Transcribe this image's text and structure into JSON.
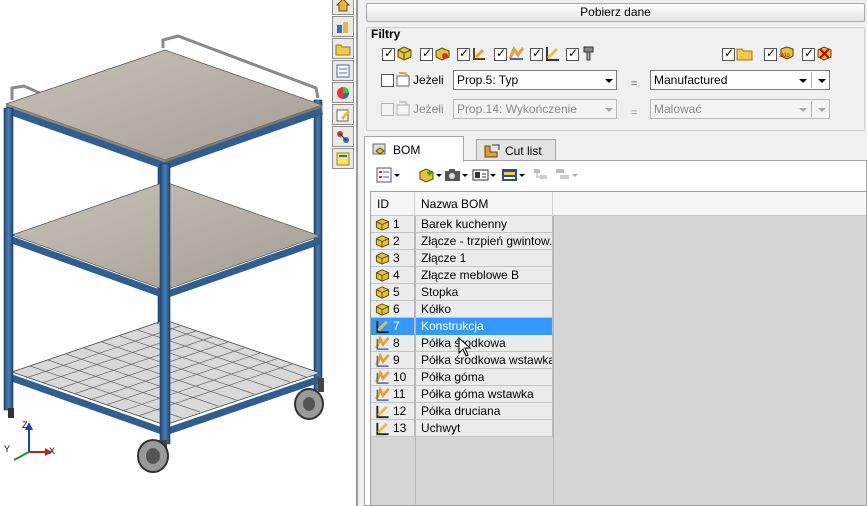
{
  "viewport": {
    "axis_labels": {
      "x": "X",
      "y": "Y",
      "z": "Z"
    }
  },
  "side_toolbar": {
    "icons": [
      "home-icon",
      "assembly-icon",
      "folder-icon",
      "properties-icon",
      "appearance-icon",
      "edit-icon",
      "routing-icon",
      "notes-icon"
    ]
  },
  "panel": {
    "fetch_button": "Pobierz dane",
    "filters": {
      "title": "Filtry",
      "type_filters": [
        {
          "icon": "part-icon",
          "checked": true
        },
        {
          "icon": "assembly-part-icon",
          "checked": true
        },
        {
          "icon": "weldment-icon",
          "checked": true
        },
        {
          "icon": "sheetmetal-icon",
          "checked": true
        },
        {
          "icon": "structural-member-icon",
          "checked": true
        },
        {
          "icon": "fastener-icon",
          "checked": true
        }
      ],
      "extra_filters": [
        {
          "icon": "folder-icon",
          "checked": true
        },
        {
          "icon": "skip-icon",
          "checked": true,
          "label": "skip"
        },
        {
          "icon": "exclude-icon",
          "checked": true
        }
      ],
      "conditions": [
        {
          "enabled": true,
          "checked": false,
          "label": "Jeżeli",
          "property": "Prop.5: Typ",
          "operator": "=",
          "value": "Manufactured"
        },
        {
          "enabled": false,
          "checked": false,
          "label": "Jeżeli",
          "property": "Prop.14: Wykończenie",
          "operator": "=",
          "value": "Malować"
        }
      ]
    },
    "tabs": [
      {
        "label": "BOM",
        "active": true
      },
      {
        "label": "Cut list",
        "active": false
      }
    ],
    "bom_table": {
      "columns": [
        "ID",
        "Nazwa BOM"
      ],
      "rows": [
        {
          "id": "1",
          "name": "Barek kuchenny",
          "type": "assembly"
        },
        {
          "id": "2",
          "name": "Złącze - trzpień gwintow...",
          "type": "assembly"
        },
        {
          "id": "3",
          "name": "Złącze 1",
          "type": "assembly"
        },
        {
          "id": "4",
          "name": "Złącze meblowe B",
          "type": "assembly"
        },
        {
          "id": "5",
          "name": "Stopka",
          "type": "assembly"
        },
        {
          "id": "6",
          "name": "Kółko",
          "type": "assembly"
        },
        {
          "id": "7",
          "name": "Konstrukcja",
          "type": "weldment",
          "selected": true
        },
        {
          "id": "8",
          "name": "Półka środkowa",
          "type": "sheetmetal"
        },
        {
          "id": "9",
          "name": "Półka środkowa wstawka",
          "type": "sheetmetal"
        },
        {
          "id": "10",
          "name": "Półka góma",
          "type": "sheetmetal"
        },
        {
          "id": "11",
          "name": "Półka góma wstawka",
          "type": "sheetmetal"
        },
        {
          "id": "12",
          "name": "Półka druciana",
          "type": "weldment"
        },
        {
          "id": "13",
          "name": "Uchwyt",
          "type": "weldment"
        }
      ]
    }
  },
  "colors": {
    "frame_blue": "#2f5f8f",
    "shelf_gray": "#b0a89f",
    "selection": "#3399ff"
  }
}
